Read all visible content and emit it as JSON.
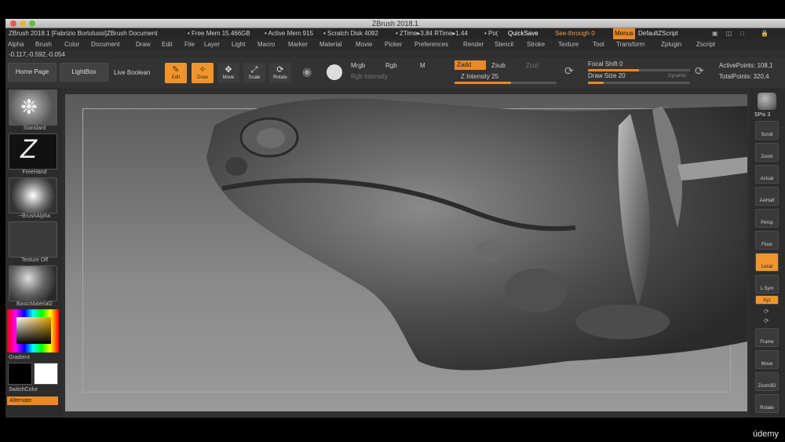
{
  "window": {
    "title": "ZBrush 2018.1"
  },
  "status": {
    "doc": "ZBrush 2018.1 [Fabrizio Bortolussi]ZBrush Document",
    "free_mem": "• Free Mem 15.466GB",
    "active_mem": "• Active Mem 915",
    "scratch": "• Scratch Disk 4092",
    "ztime": "• ZTime▸3.84 RTime▸1.44",
    "pol": "• Po(",
    "quicksave": "QuickSave",
    "see_through": "See-through  0",
    "menus": "Menus",
    "script": "DefaultZScript"
  },
  "menu": [
    "Alpha",
    "Brush",
    "Color",
    "Document",
    "Draw",
    "Edit",
    "File",
    "Layer",
    "Light",
    "Macro",
    "Marker",
    "Material",
    "Movie",
    "Picker",
    "Preferences",
    "Render",
    "Stencil",
    "Stroke",
    "Texture",
    "Tool",
    "Transform",
    "Zplugin",
    "Zscript"
  ],
  "coords": "-0.117,-0.592,-0.054",
  "toolbar": {
    "home": "Home Page",
    "lightbox": "LightBox",
    "live_boolean": "Live Boolean",
    "edit": "Edit",
    "draw": "Draw",
    "move": "Move",
    "scale": "Scale",
    "rotate": "Rotate",
    "mrgb": "Mrgb",
    "rgb": "Rgb",
    "m": "M",
    "rgb_intensity": "Rgb Intensity",
    "zadd": "Zadd",
    "zsub": "Zsub",
    "zcut": "Zcut",
    "z_intensity": "Z Intensity 25",
    "focal_shift": "Focal Shift 0",
    "draw_size": "Draw Size 20",
    "dynamic": "Dynamic",
    "active_points": "ActivePoints: 108,1",
    "total_points": "TotalPoints: 320,4"
  },
  "left": {
    "brush": "Standard",
    "stroke": "FreeHand",
    "alpha": "~BrushAlpha",
    "texture": "Texture Off",
    "material": "BasicMaterial2",
    "gradient": "Gradient",
    "switch_color": "SwitchColor",
    "alternate": "Alternate"
  },
  "right": {
    "spix": "SPix 3",
    "buttons": [
      "Scroll",
      "Zoom",
      "Actual",
      "AAHalf",
      "Persp",
      "Floor",
      "Local",
      "L.Sym",
      "Xyz",
      "Frame",
      "Move",
      "Zoom3D",
      "Rotate"
    ]
  },
  "watermark": "údemy",
  "colors": {
    "accent": "#f0952c",
    "panel": "#2f2f2f"
  }
}
